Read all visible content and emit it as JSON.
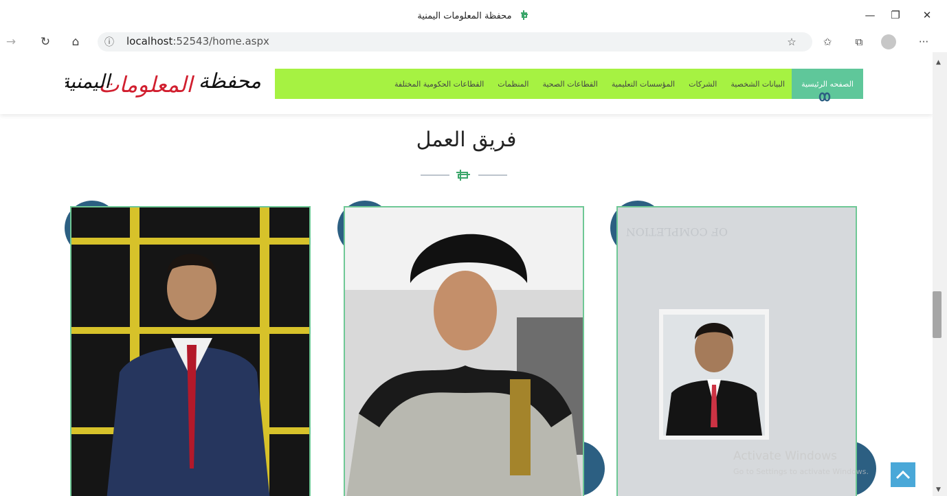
{
  "window": {
    "title": "محفظة المعلومات اليمنية",
    "minimize": "—",
    "restore": "❐",
    "close": "✕"
  },
  "toolbar": {
    "back_icon": "→",
    "reload_icon": "↻",
    "home_icon": "⌂",
    "info_icon": "ⓘ",
    "url_host": "localhost",
    "url_rest": ":52543/home.aspx",
    "fav_icon": "☆",
    "favs_icon": "✩",
    "collections_icon": "⧉",
    "more_icon": "···"
  },
  "site": {
    "logo_text_black": "محفظة",
    "logo_text_red": "المعلومات",
    "logo_text_black2": "اليمنية",
    "menu": [
      {
        "label": "الصفحه الرئيسية",
        "active": true
      },
      {
        "label": "البيانات الشخصية",
        "active": false
      },
      {
        "label": "الشركات",
        "active": false
      },
      {
        "label": "المؤسسات التعليمية",
        "active": false
      },
      {
        "label": "القطاعات الصحية",
        "active": false
      },
      {
        "label": "المنظمات",
        "active": false
      },
      {
        "label": "القطاعات الحكومية المختلفة",
        "active": false
      }
    ]
  },
  "section": {
    "title": "فريق العمل"
  },
  "overlay": {
    "watermark_line1": "Activate Windows",
    "watermark_line2": "Go to Settings to activate Windows."
  },
  "colors": {
    "menu_bg": "#a6f242",
    "menu_active": "#5fc79a",
    "card_border": "#6ec895",
    "circle": "#2c5f82",
    "logo_red": "#d11f2f"
  }
}
